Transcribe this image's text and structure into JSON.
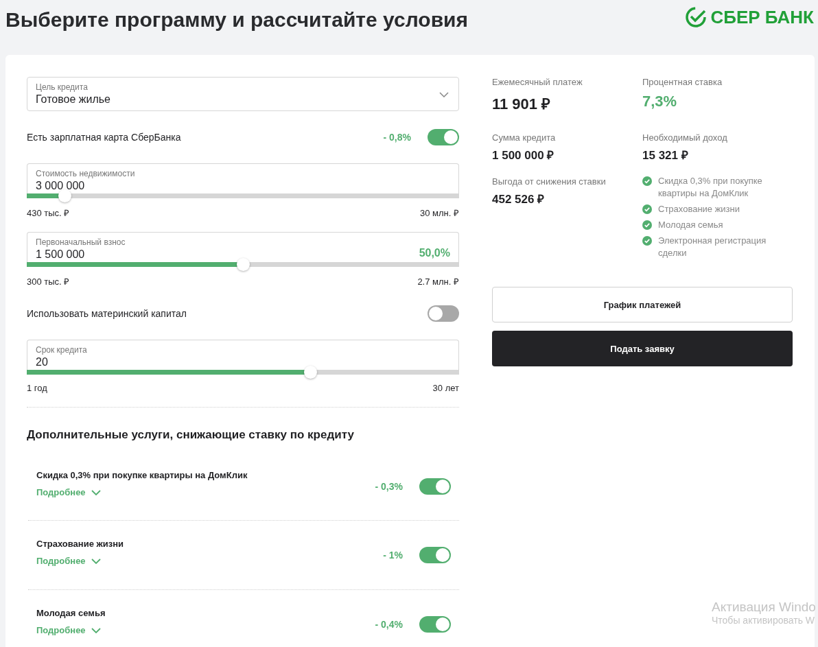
{
  "header": {
    "title": "Выберите программу и рассчитайте условия",
    "logo": "СБЕР БАНК"
  },
  "form": {
    "purpose": {
      "label": "Цель кредита",
      "value": "Готовое жилье"
    },
    "controls": [
      {
        "kind": "toggle",
        "label": "Есть зарплатная карта СберБанка",
        "discount": "- 0,8%",
        "on": true
      },
      {
        "kind": "slider",
        "label": "Стоимость недвижимости",
        "value": "3 000 000",
        "level": 0.087,
        "min": "430 тыс. ₽",
        "max": "30 млн. ₽"
      },
      {
        "kind": "slider",
        "label": "Первоначальный взнос",
        "value": "1 500 000",
        "percent": "50,0%",
        "level": 0.5,
        "min": "300 тыс. ₽",
        "max": "2.7 млн. ₽"
      },
      {
        "kind": "toggle",
        "label": "Использовать материнский капитал",
        "on": false
      },
      {
        "kind": "slider",
        "label": "Срок кредита",
        "value": "20",
        "level": 0.655,
        "min": "1 год",
        "max": "30 лет"
      }
    ],
    "services_title": "Дополнительные услуги, снижающие ставку по кредиту",
    "services": [
      {
        "name": "Скидка 0,3% при покупке квартиры на ДомКлик",
        "more": "Подробнее",
        "discount": "- 0,3%",
        "on": true
      },
      {
        "name": "Страхование жизни",
        "more": "Подробнее",
        "discount": "- 1%",
        "on": true
      },
      {
        "name": "Молодая семья",
        "more": "Подробнее",
        "discount": "- 0,4%",
        "on": true
      }
    ]
  },
  "summary": {
    "figures": [
      {
        "label": "Ежемесячный платеж",
        "value": "11 901 ₽",
        "kind": "headline",
        "highlight": false
      },
      {
        "label": "Процентная ставка",
        "value": "7,3%",
        "kind": "headline",
        "highlight": true
      },
      {
        "label": "Сумма кредита",
        "value": "1 500 000 ₽",
        "kind": "regular",
        "highlight": false
      },
      {
        "label": "Необходимый доход",
        "value": "15 321 ₽",
        "kind": "regular",
        "highlight": false
      },
      {
        "label": "Выгода от снижения ставки",
        "value": "452 526 ₽",
        "kind": "regular",
        "highlight": false
      }
    ],
    "benefits": [
      "Скидка 0,3% при покупке квартиры на ДомКлик",
      "Страхование жизни",
      "Молодая семья",
      "Электронная регистрация сделки"
    ],
    "buttons": [
      {
        "label": "График платежей",
        "kind": "secondary"
      },
      {
        "label": "Подать заявку",
        "kind": "primary"
      }
    ]
  },
  "os_overlay": {
    "title": "Активация Windo",
    "subtitle": "Чтобы активировать W"
  }
}
